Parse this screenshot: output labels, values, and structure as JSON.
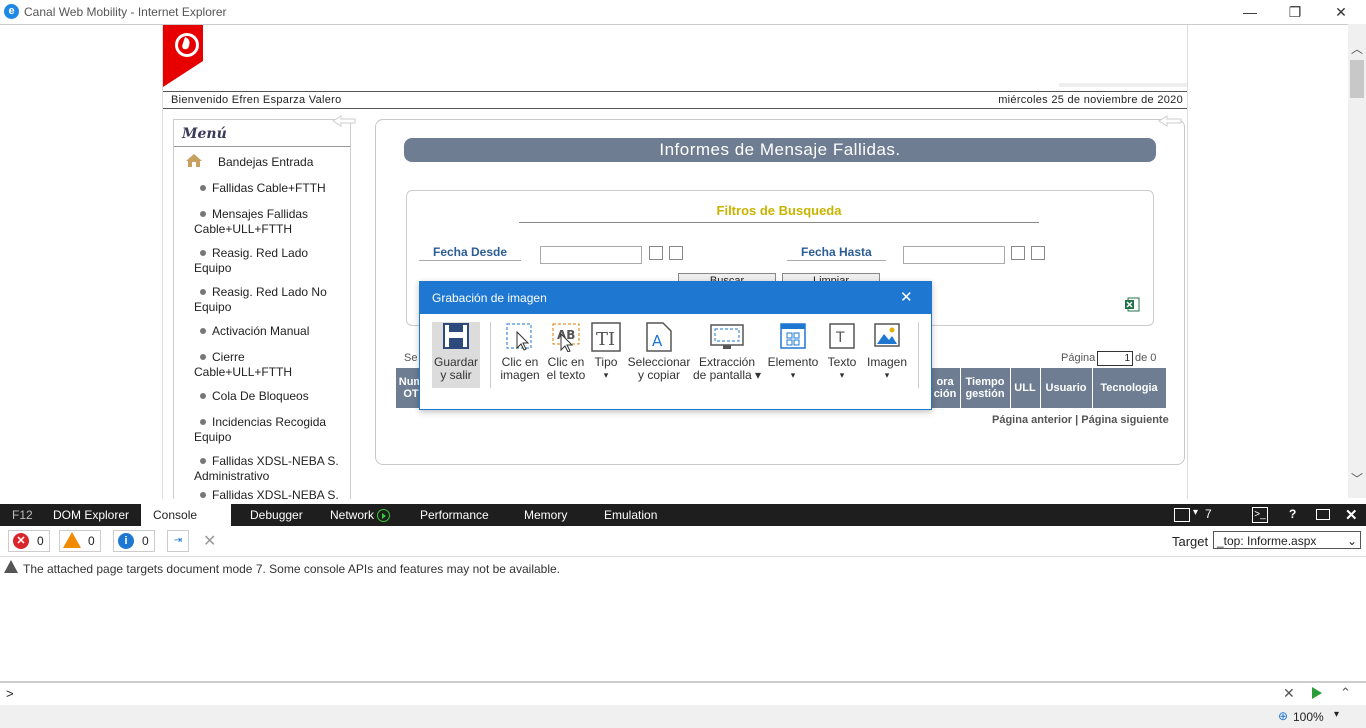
{
  "window": {
    "title": "Canal Web Mobility - Internet Explorer",
    "ie_icon": "e",
    "minimize": "—",
    "restore": "❐",
    "close": "✕"
  },
  "page": {
    "welcome": "Bienvenido Efren Esparza Valero",
    "date": "miércoles 25 de noviembre de 2020",
    "menu_title": "Menú",
    "menu_items": [
      "Bandejas Entrada",
      "Fallidas Cable+FTTH",
      "Mensajes Fallidas Cable+ULL+FTTH",
      "Reasig. Red Lado Equipo",
      "Reasig. Red Lado No Equipo",
      "Activación Manual",
      "Cierre Cable+ULL+FTTH",
      "Cola De Bloqueos",
      "Incidencias Recogida Equipo",
      "Fallidas XDSL-NEBA S. Administrativo",
      "Fallidas XDSL-NEBA S."
    ],
    "report_title": "Informes de Mensaje Fallidas.",
    "filters_title": "Filtros de Busqueda",
    "fecha_desde": "Fecha Desde",
    "fecha_hasta": "Fecha Hasta",
    "buscar": "Buscar",
    "limpiar": "Limpiar",
    "se_label": "Se",
    "pagina_label": "Página",
    "pagina_value": "1",
    "de_label": "de 0",
    "columns": [
      "Num OT",
      "ora ción",
      "Tiempo gestión",
      "ULL",
      "Usuario",
      "Tecnologia"
    ],
    "pagina_anterior": "Página anterior",
    "separator": "|",
    "pagina_siguiente": "Página siguiente"
  },
  "dialog": {
    "title": "Grabación de imagen",
    "close": "✕",
    "tools": [
      {
        "line1": "Guardar",
        "line2": "y salir",
        "icon": "save-icon"
      },
      {
        "line1": "Clic en",
        "line2": "imagen",
        "icon": "click-image-icon"
      },
      {
        "line1": "Clic en",
        "line2": "el texto",
        "icon": "click-text-icon"
      },
      {
        "line1": "Tipo",
        "line2": "▾",
        "icon": "type-icon"
      },
      {
        "line1": "Seleccionar",
        "line2": "y copiar",
        "icon": "select-copy-icon"
      },
      {
        "line1": "Extracción",
        "line2": "de pantalla ▾",
        "icon": "screen-extract-icon"
      },
      {
        "line1": "Elemento",
        "line2": "▾",
        "icon": "element-icon"
      },
      {
        "line1": "Texto",
        "line2": "▾",
        "icon": "text-icon"
      },
      {
        "line1": "Imagen",
        "line2": "▾",
        "icon": "image-icon"
      }
    ]
  },
  "devtools": {
    "tabs": [
      "F12",
      "DOM Explorer",
      "Console",
      "Debugger",
      "Network",
      "Performance",
      "Memory",
      "Emulation"
    ],
    "active_tab": "Console",
    "emulation_count": "7",
    "help": "?",
    "errors": "0",
    "warnings": "0",
    "infos": "0",
    "target_label": "Target",
    "target_value": "_top: Informe.aspx",
    "message": "The attached page targets document mode 7. Some console APIs and features may not be available.",
    "prompt": ">",
    "zoom": "100%"
  },
  "colors": {
    "accent": "#1e78d2",
    "header_blue": "#6e7d92",
    "filter_title": "#c8b400",
    "label_blue": "#2c5d95",
    "vodafone_red": "#e60000"
  }
}
